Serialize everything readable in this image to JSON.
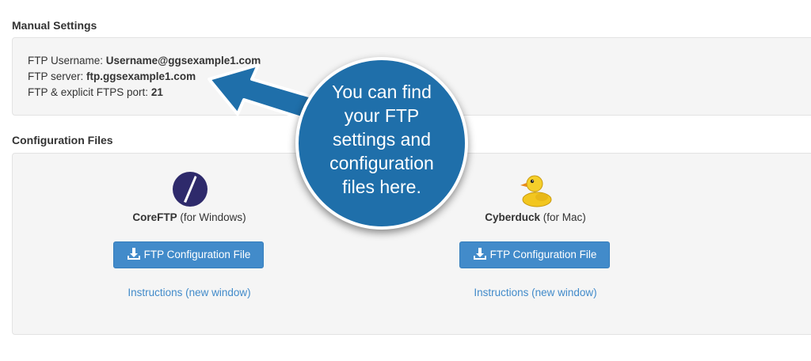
{
  "manual": {
    "title": "Manual Settings",
    "username_label": "FTP Username:",
    "username_value": "Username@ggsexample1.com",
    "server_label": "FTP server:",
    "server_value": "ftp.ggsexample1.com",
    "port_label": "FTP & explicit FTPS port:",
    "port_value": "21"
  },
  "config": {
    "title": "Configuration Files",
    "clients": [
      {
        "name": "CoreFTP",
        "platform": "(for Windows)",
        "button_label": "FTP Configuration File",
        "instructions_label": "Instructions (new window)",
        "logo_icon": "coreftp-logo-icon",
        "logo_color": "#2e2a6b"
      },
      {
        "name": "Cyberduck",
        "platform": "(for Mac)",
        "button_label": "FTP Configuration File",
        "instructions_label": "Instructions (new window)",
        "logo_icon": "cyberduck-logo-icon",
        "logo_color": "#f2c61f"
      }
    ]
  },
  "callout": {
    "lines": [
      "You can find",
      "your FTP",
      "settings and",
      "configuration",
      "files here."
    ],
    "color": "#1f6faa"
  },
  "colors": {
    "accent": "#428bca",
    "panel_bg": "#f5f5f5"
  }
}
